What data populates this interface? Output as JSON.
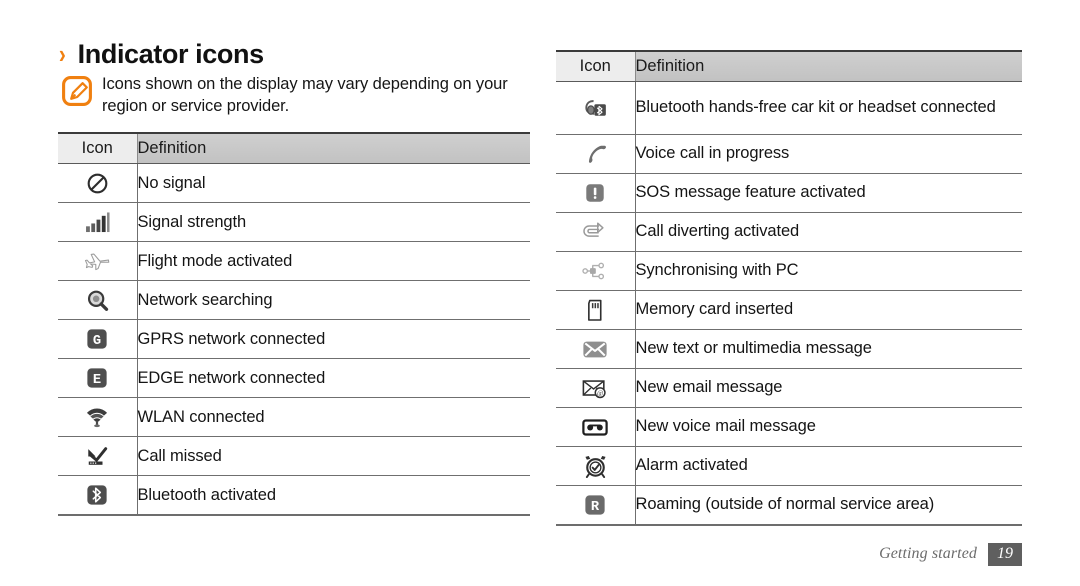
{
  "heading": {
    "chevron": "›",
    "title": "Indicator icons"
  },
  "note": {
    "icon": "note-pencil-icon",
    "text": "Icons shown on the display may vary depending on your region or service provider."
  },
  "tables": {
    "left": {
      "headers": {
        "icon": "Icon",
        "definition": "Definition"
      },
      "rows": [
        {
          "icon": "no-signal-icon",
          "definition": "No signal"
        },
        {
          "icon": "signal-strength-icon",
          "definition": "Signal strength"
        },
        {
          "icon": "flight-mode-icon",
          "definition": "Flight mode activated"
        },
        {
          "icon": "network-searching-icon",
          "definition": "Network searching"
        },
        {
          "icon": "gprs-icon",
          "definition": "GPRS network connected"
        },
        {
          "icon": "edge-icon",
          "definition": "EDGE network connected"
        },
        {
          "icon": "wlan-icon",
          "definition": "WLAN connected"
        },
        {
          "icon": "call-missed-icon",
          "definition": "Call missed"
        },
        {
          "icon": "bluetooth-icon",
          "definition": "Bluetooth activated"
        }
      ]
    },
    "right": {
      "headers": {
        "icon": "Icon",
        "definition": "Definition"
      },
      "rows": [
        {
          "icon": "bluetooth-headset-icon",
          "definition": "Bluetooth hands-free car kit or headset connected"
        },
        {
          "icon": "voice-call-icon",
          "definition": "Voice call in progress"
        },
        {
          "icon": "sos-message-icon",
          "definition": "SOS message feature activated"
        },
        {
          "icon": "call-diverting-icon",
          "definition": "Call diverting activated"
        },
        {
          "icon": "sync-pc-icon",
          "definition": "Synchronising with PC"
        },
        {
          "icon": "memory-card-icon",
          "definition": "Memory card inserted"
        },
        {
          "icon": "new-message-icon",
          "definition": "New text or multimedia message"
        },
        {
          "icon": "new-email-icon",
          "definition": "New email message"
        },
        {
          "icon": "voice-mail-icon",
          "definition": "New voice mail message"
        },
        {
          "icon": "alarm-icon",
          "definition": "Alarm activated"
        },
        {
          "icon": "roaming-icon",
          "definition": "Roaming (outside of normal service area)"
        }
      ]
    }
  },
  "footer": {
    "label": "Getting started",
    "page_number": "19"
  },
  "colors": {
    "accent": "#f08010",
    "header_icon_bg": "#ededed",
    "header_def_bg": "#c8c8c8",
    "rule": "#6f6f6f",
    "footer_text": "#6c6c6c",
    "page_badge_bg": "#5f5f5f"
  }
}
